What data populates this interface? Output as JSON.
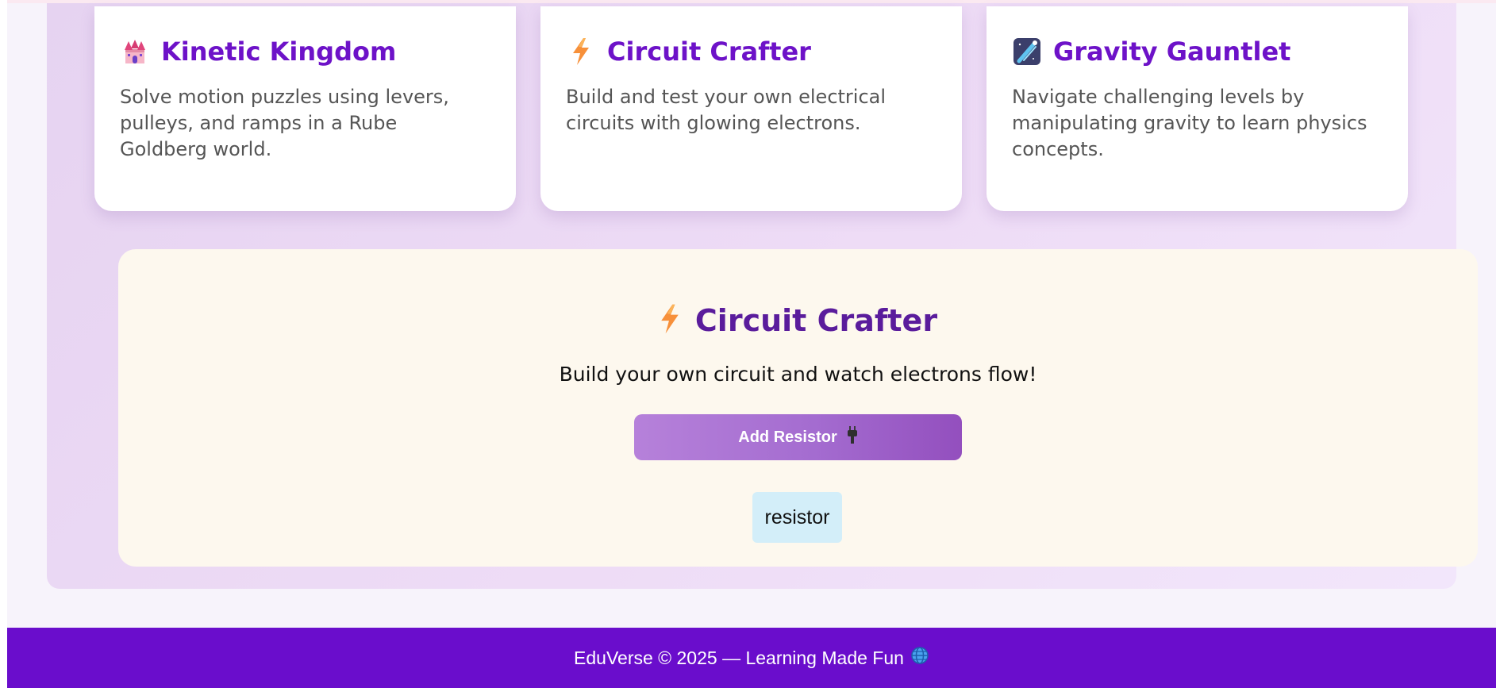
{
  "games": [
    {
      "title": "Kinetic Kingdom",
      "description": "Solve motion puzzles using levers, pulleys, and ramps in a Rube Goldberg world.",
      "icon": "castle-icon"
    },
    {
      "title": "Circuit Crafter",
      "description": "Build and test your own electrical circuits with glowing electrons.",
      "icon": "lightning-icon"
    },
    {
      "title": "Gravity Gauntlet",
      "description": "Navigate challenging levels by manipulating gravity to learn physics concepts.",
      "icon": "comet-icon"
    }
  ],
  "demo": {
    "title": "Circuit Crafter",
    "icon": "lightning-icon",
    "subtitle": "Build your own circuit and watch electrons flow!",
    "add_button_label": "Add Resistor",
    "add_button_icon": "plug-icon",
    "components": [
      "resistor"
    ]
  },
  "footer": {
    "text": "EduVerse © 2025 — Learning Made Fun",
    "icon": "globe-icon"
  },
  "colors": {
    "accent": "#6d12c8",
    "footer_bg": "#6a0dcc",
    "demo_bg": "#fdf8ee",
    "component_bg": "#d3eef9"
  }
}
